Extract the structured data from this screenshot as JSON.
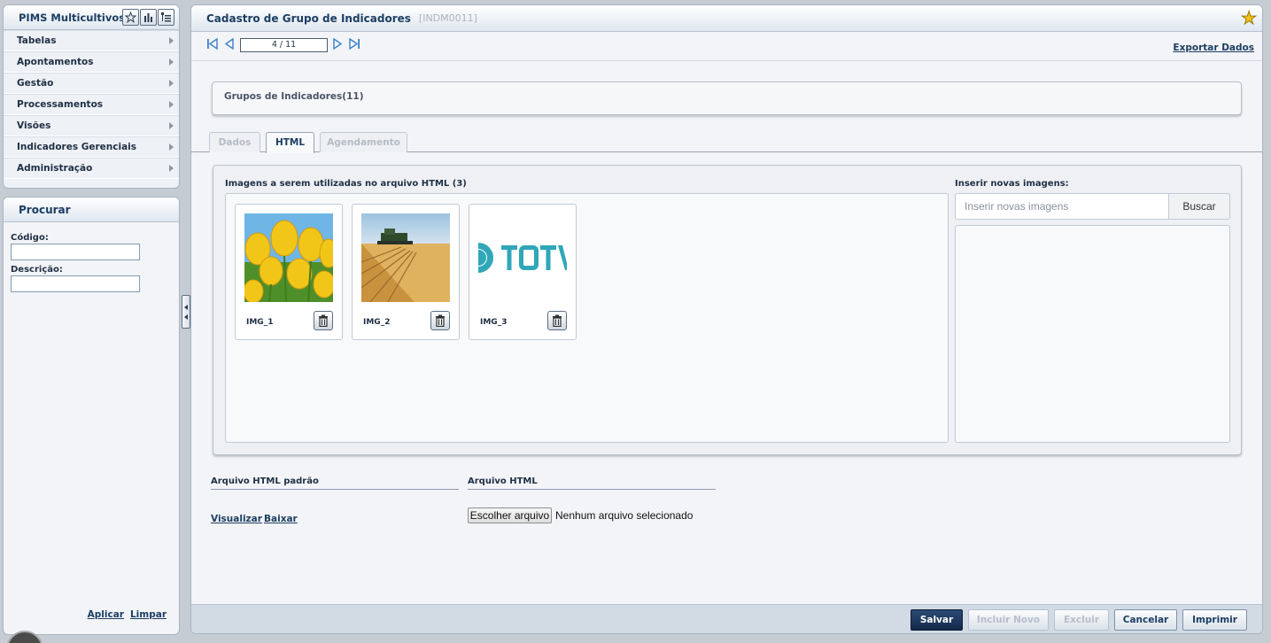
{
  "sidebar": {
    "app_title": "PIMS Multicultivos",
    "tools": [
      {
        "icon": "star-outline-icon"
      },
      {
        "icon": "bar-chart-icon"
      },
      {
        "icon": "list-tree-icon"
      }
    ],
    "menu": [
      {
        "label": "Tabelas"
      },
      {
        "label": "Apontamentos"
      },
      {
        "label": "Gestão"
      },
      {
        "label": "Processamentos"
      },
      {
        "label": "Visões"
      },
      {
        "label": "Indicadores Gerenciais"
      },
      {
        "label": "Administração"
      }
    ]
  },
  "search": {
    "title": "Procurar",
    "codigo_label": "Código:",
    "descricao_label": "Descrição:",
    "apply_label": "Aplicar",
    "clear_label": "Limpar"
  },
  "main": {
    "title": "Cadastro de Grupo de Indicadores",
    "code": "[INDM0011]",
    "pager_value": "4 / 11",
    "export_label": "Exportar Dados",
    "group_label": "Grupos de Indicadores(11)",
    "tabs": [
      {
        "label": "Dados",
        "active": false
      },
      {
        "label": "HTML",
        "active": true
      },
      {
        "label": "Agendamento",
        "active": false
      }
    ],
    "images_label": "Imagens a serem utilizadas no arquivo HTML (3)",
    "images": [
      {
        "name": "IMG_1",
        "kind": "yellow-tulips"
      },
      {
        "name": "IMG_2",
        "kind": "wheat-harvester"
      },
      {
        "name": "IMG_3",
        "kind": "totvs-logo"
      }
    ],
    "insert_label": "Inserir novas imagens:",
    "insert_placeholder": "Inserir novas imagens",
    "search_button": "Buscar",
    "default_html_label": "Arquivo HTML padrão",
    "view_link": "Visualizar",
    "download_link": "Baixar",
    "html_file_label": "Arquivo HTML",
    "choose_file_button": "Escolher arquivo",
    "no_file_text": "Nenhum arquivo selecionado"
  },
  "footer": {
    "save": "Salvar",
    "new": "Incluir Novo",
    "delete": "Excluir",
    "cancel": "Cancelar",
    "print": "Imprimir"
  },
  "colors": {
    "accent": "#1c3e63",
    "primary_button": "#1a3358",
    "star": "#f2c21b"
  }
}
